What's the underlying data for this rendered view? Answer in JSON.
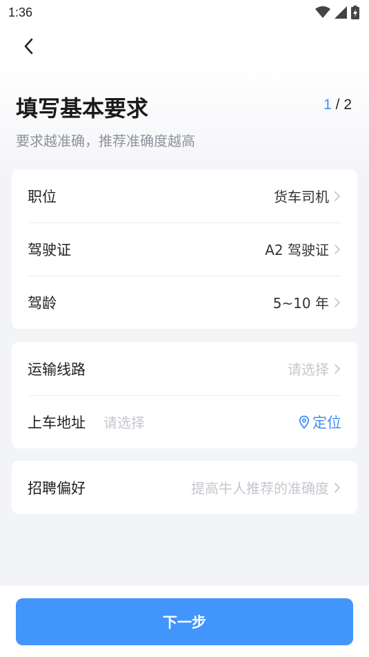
{
  "status_bar": {
    "time": "1:36",
    "icons": [
      "wifi-icon",
      "signal-icon",
      "battery-charging-icon"
    ]
  },
  "header": {
    "back_icon": "chevron-left-icon",
    "title": "填写基本要求",
    "step_current": "1",
    "step_separator": " / ",
    "step_total": "2",
    "subtitle": "要求越准确，推荐准确度越高"
  },
  "card1": {
    "rows": [
      {
        "label": "职位",
        "value": "货车司机"
      },
      {
        "label": "驾驶证",
        "value": "A2 驾驶证"
      },
      {
        "label": "驾龄",
        "value": "5~10 年"
      }
    ]
  },
  "card2": {
    "route": {
      "label": "运输线路",
      "placeholder": "请选择"
    },
    "address": {
      "label": "上车地址",
      "placeholder": "请选择",
      "locate_label": "定位",
      "locate_icon": "location-pin-icon"
    }
  },
  "card3": {
    "preference": {
      "label": "招聘偏好",
      "placeholder": "提高牛人推荐的准确度"
    }
  },
  "footer": {
    "next_label": "下一步"
  },
  "colors": {
    "accent": "#4195fb",
    "placeholder": "#c4c7cd",
    "background": "#f3f4f8"
  }
}
